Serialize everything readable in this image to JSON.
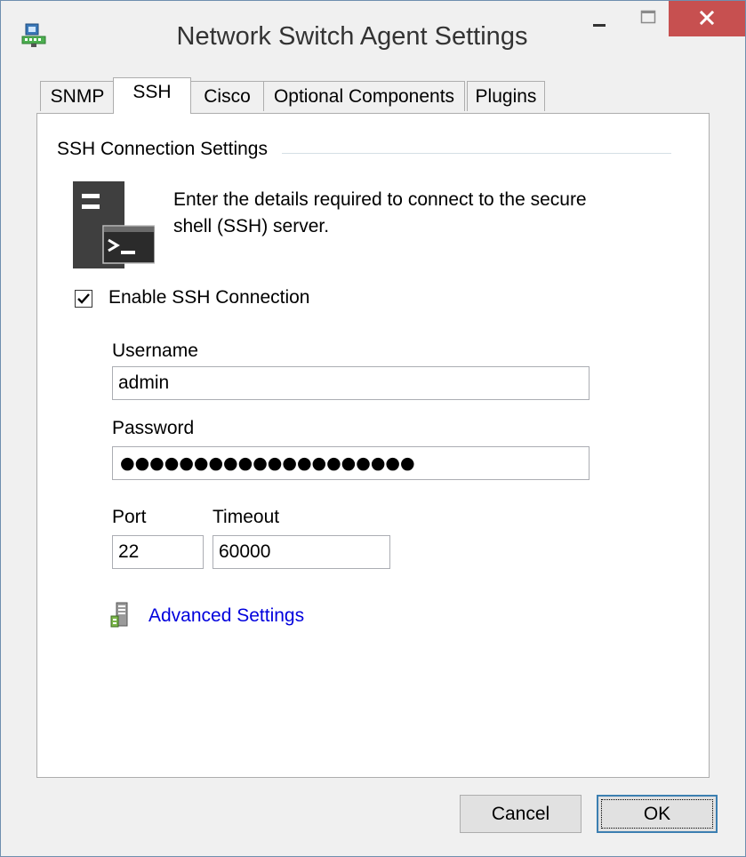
{
  "window": {
    "title": "Network Switch Agent Settings",
    "accent_close": "#c75050"
  },
  "tabs": [
    {
      "label": "SNMP",
      "active": false
    },
    {
      "label": "SSH",
      "active": true
    },
    {
      "label": "Cisco",
      "active": false
    },
    {
      "label": "Optional Components",
      "active": false
    },
    {
      "label": "Plugins",
      "active": false
    }
  ],
  "ssh": {
    "group_title": "SSH Connection Settings",
    "description": "Enter the details required to connect to the secure shell (SSH) server.",
    "enable_label": "Enable SSH Connection",
    "enable_checked": true,
    "username_label": "Username",
    "username_value": "admin",
    "password_label": "Password",
    "password_mask": "●●●●●●●●●●●●●●●●●●●●",
    "port_label": "Port",
    "port_value": "22",
    "timeout_label": "Timeout",
    "timeout_value": "60000",
    "advanced_link": "Advanced Settings",
    "link_color": "#0000dd"
  },
  "buttons": {
    "cancel": "Cancel",
    "ok": "OK"
  }
}
